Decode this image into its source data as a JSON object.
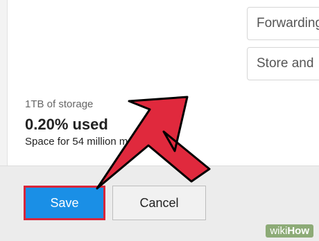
{
  "options": [
    {
      "label": "Forwarding"
    },
    {
      "label": "Store and"
    }
  ],
  "storage": {
    "title": "1TB of storage",
    "used": "0.20% used",
    "space": "Space for 54 million m"
  },
  "buttons": {
    "save_label": "Save",
    "cancel_label": "Cancel"
  },
  "overlay": {
    "arrow_color": "#e0293d",
    "arrow_outline": "#000000",
    "logo_text_light": "wiki",
    "logo_text_bold": "How"
  },
  "colors": {
    "save_button": "#1a8fe6",
    "save_highlight": "#d8263a",
    "cancel_button": "#f1f1f1"
  }
}
